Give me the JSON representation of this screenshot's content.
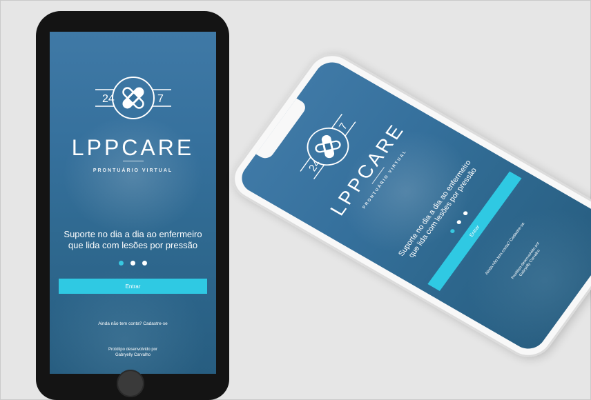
{
  "app": {
    "logo_number_left": "24",
    "logo_number_right": "7",
    "brand": "LPPCARE",
    "subtitle": "PRONTUÁRIO VIRTUAL",
    "tagline_line1": "Suporte no dia a dia ao enfermeiro",
    "tagline_line2": "que lida com lesões por pressão",
    "carousel_total": 3,
    "carousel_active": 1,
    "enter_label": "Entrar",
    "signup_text": "Ainda não tem conta? Cadastre-se",
    "credit_line1": "Protótipo desenvolvido por",
    "credit_line2": "Gabryelly Carvalho"
  },
  "colors": {
    "screen_blue": "#35709c",
    "accent_cyan": "#2fc9e3",
    "phone_black": "#141414",
    "phone_white": "#f8f8f8",
    "background": "#e6e6e6"
  },
  "icons": {
    "logo": "bandage-cross-icon",
    "home": "home-button-icon"
  }
}
